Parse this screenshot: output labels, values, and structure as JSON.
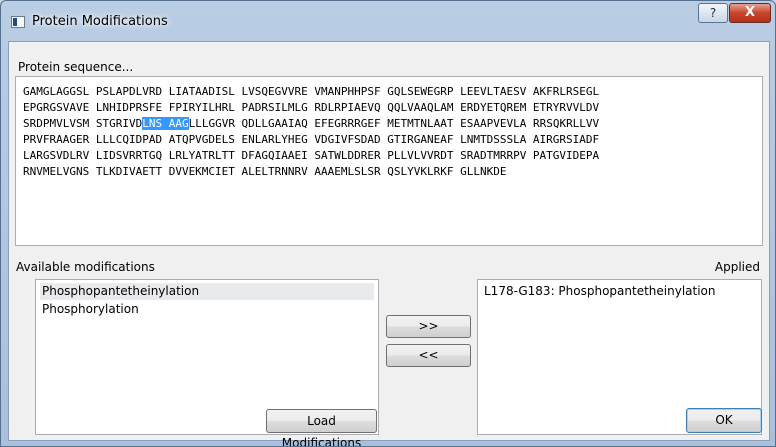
{
  "window": {
    "title": "Protein Modifications",
    "help_glyph": "?",
    "close_glyph": "X"
  },
  "sequence": {
    "label": "Protein sequence...",
    "lines": [
      "GAMGLAGGSL PSLAPDLVRD LIATAADISL LVSQEGVVRE VMANPHHPSF GQLSEWEGRP LEEVLTAESV AKFRLRSEGL",
      "EPGRGSVAVE LNHIDPRSFE FPIRYILHRL PADRSILMLG RDLRPIAEVQ QQLVAAQLAM ERDYETQREM ETRYRVVLDV",
      "",
      "PRVFRAAGER LLLCQIDPAD ATQPVGDELS ENLARLYHEG VDGIVFSDAD GTIRGANEAF LNMTDSSSLA AIRGRSIADF",
      "LARGSVDLRV LIDSVRRTGQ LRLYATRLTT DFAGQIAAEI SATWLDDRER PLLVLVVRDT SRADTMRRPV PATGVIDEPA",
      "RNVMELVGNS TLKDIVAETT DVVEKMCIET ALELTRNNRV AAAEMLSLSR QSLYVKLRKF GLLNKDE"
    ],
    "line3_before": "SRDPMVLVSM STGRIVD",
    "line3_selected": "LNS AAG",
    "line3_after": "LLLGGVR QDLLGAAIAQ EFEGRRRGEF METMTNLAAT ESAAPVEVLA RRSQKRLLVV"
  },
  "available": {
    "label": "Available modifications",
    "items": [
      "Phosphopantetheinylation",
      "Phosphorylation"
    ]
  },
  "applied": {
    "label": "Applied",
    "items": [
      "L178-G183: Phosphopantetheinylation"
    ]
  },
  "buttons": {
    "add": ">>",
    "remove": "<<",
    "load": "Load Modifications",
    "ok": "OK"
  }
}
